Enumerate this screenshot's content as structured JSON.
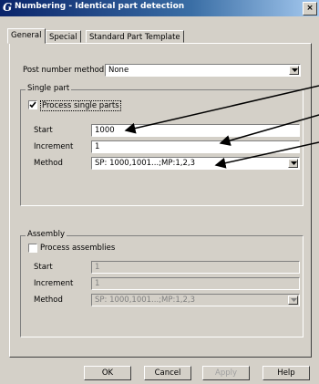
{
  "window": {
    "title": "Numbering - Identical part detection",
    "icon_glyph": "G",
    "close_glyph": "×"
  },
  "tabs": [
    {
      "label": "General"
    },
    {
      "label": "Special"
    },
    {
      "label": "Standard Part Template"
    }
  ],
  "post_number": {
    "label": "Post number method",
    "value": "None"
  },
  "single_part": {
    "legend": "Single part",
    "process_label": "Process single parts",
    "process_checked": true,
    "start_label": "Start",
    "start_value": "1000",
    "increment_label": "Increment",
    "increment_value": "1",
    "method_label": "Method",
    "method_value": "SP: 1000,1001...;MP:1,2,3"
  },
  "assembly": {
    "legend": "Assembly",
    "process_label": "Process assemblies",
    "process_checked": false,
    "start_label": "Start",
    "start_value": "1",
    "increment_label": "Increment",
    "increment_value": "1",
    "method_label": "Method",
    "method_value": "SP: 1000,1001...;MP:1,2,3"
  },
  "buttons": {
    "ok": "OK",
    "cancel": "Cancel",
    "apply": "Apply",
    "help": "Help"
  }
}
